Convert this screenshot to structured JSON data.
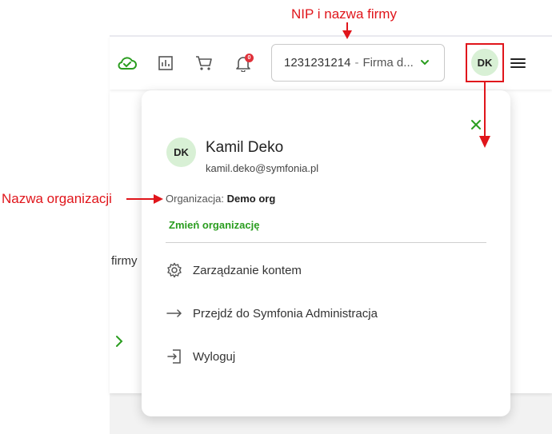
{
  "annotations": {
    "nip_label": "NIP i nazwa firmy",
    "org_label": "Nazwa organizacji"
  },
  "topbar": {
    "icons": [
      "cloud-check-icon",
      "report-icon",
      "cart-icon",
      "bell-icon"
    ],
    "notification_count": "0",
    "company": {
      "nip": "1231231214",
      "separator": "-",
      "name": "Firma d..."
    },
    "avatar_initials": "DK"
  },
  "background": {
    "partial_text": "firmy"
  },
  "user_popup": {
    "initials": "DK",
    "name": "Kamil Deko",
    "email": "kamil.deko@symfonia.pl",
    "org_label": "Organizacja:",
    "org_name": "Demo org",
    "change_org": "Zmień organizację",
    "menu": [
      {
        "icon": "gear-icon",
        "label": "Zarządzanie kontem"
      },
      {
        "icon": "arrow-right-icon",
        "label": "Przejdź do Symfonia Administracja"
      },
      {
        "icon": "logout-icon",
        "label": "Wyloguj"
      }
    ]
  },
  "colors": {
    "accent_green": "#2a9d1f",
    "avatar_bg": "#d8f0d5",
    "annotation_red": "#e0151b",
    "badge_red": "#e0323b"
  }
}
